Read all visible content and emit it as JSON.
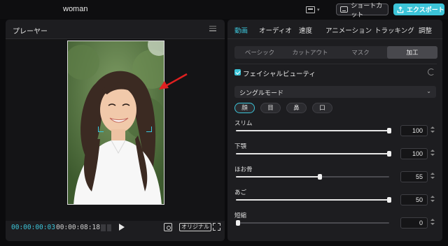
{
  "topbar": {
    "project_name": "woman",
    "shortcut_label": "ショートカット",
    "export_label": "エクスポート"
  },
  "player": {
    "title": "プレーヤー",
    "time_current": "00:00:00:03",
    "time_total": "00:00:08:18",
    "ratio_label": "オリジナル"
  },
  "inspector": {
    "tabs": [
      "動画",
      "オーディオ",
      "速度",
      "アニメーション",
      "トラッキング",
      "調整"
    ],
    "active_tab": 0,
    "subtabs": [
      "ベーシック",
      "カットアウト",
      "マスク",
      "加工"
    ],
    "active_subtab": 3,
    "face_beauty": {
      "label": "フェイシャルビューティ",
      "checked": true,
      "mode": "シングルモード",
      "parts": [
        "顔",
        "目",
        "鼻",
        "口"
      ],
      "active_part": 0,
      "sliders": [
        {
          "label": "スリム",
          "value": "100",
          "fraction": 1.0
        },
        {
          "label": "下顎",
          "value": "100",
          "fraction": 1.0
        },
        {
          "label": "ほお骨",
          "value": "55",
          "fraction": 0.55
        },
        {
          "label": "あご",
          "value": "50",
          "fraction": 1.0
        },
        {
          "label": "短縮",
          "value": "0",
          "fraction": 0.0
        }
      ]
    }
  },
  "colors": {
    "accent": "#3cc4d8",
    "annotation_arrow": "#e02020"
  }
}
